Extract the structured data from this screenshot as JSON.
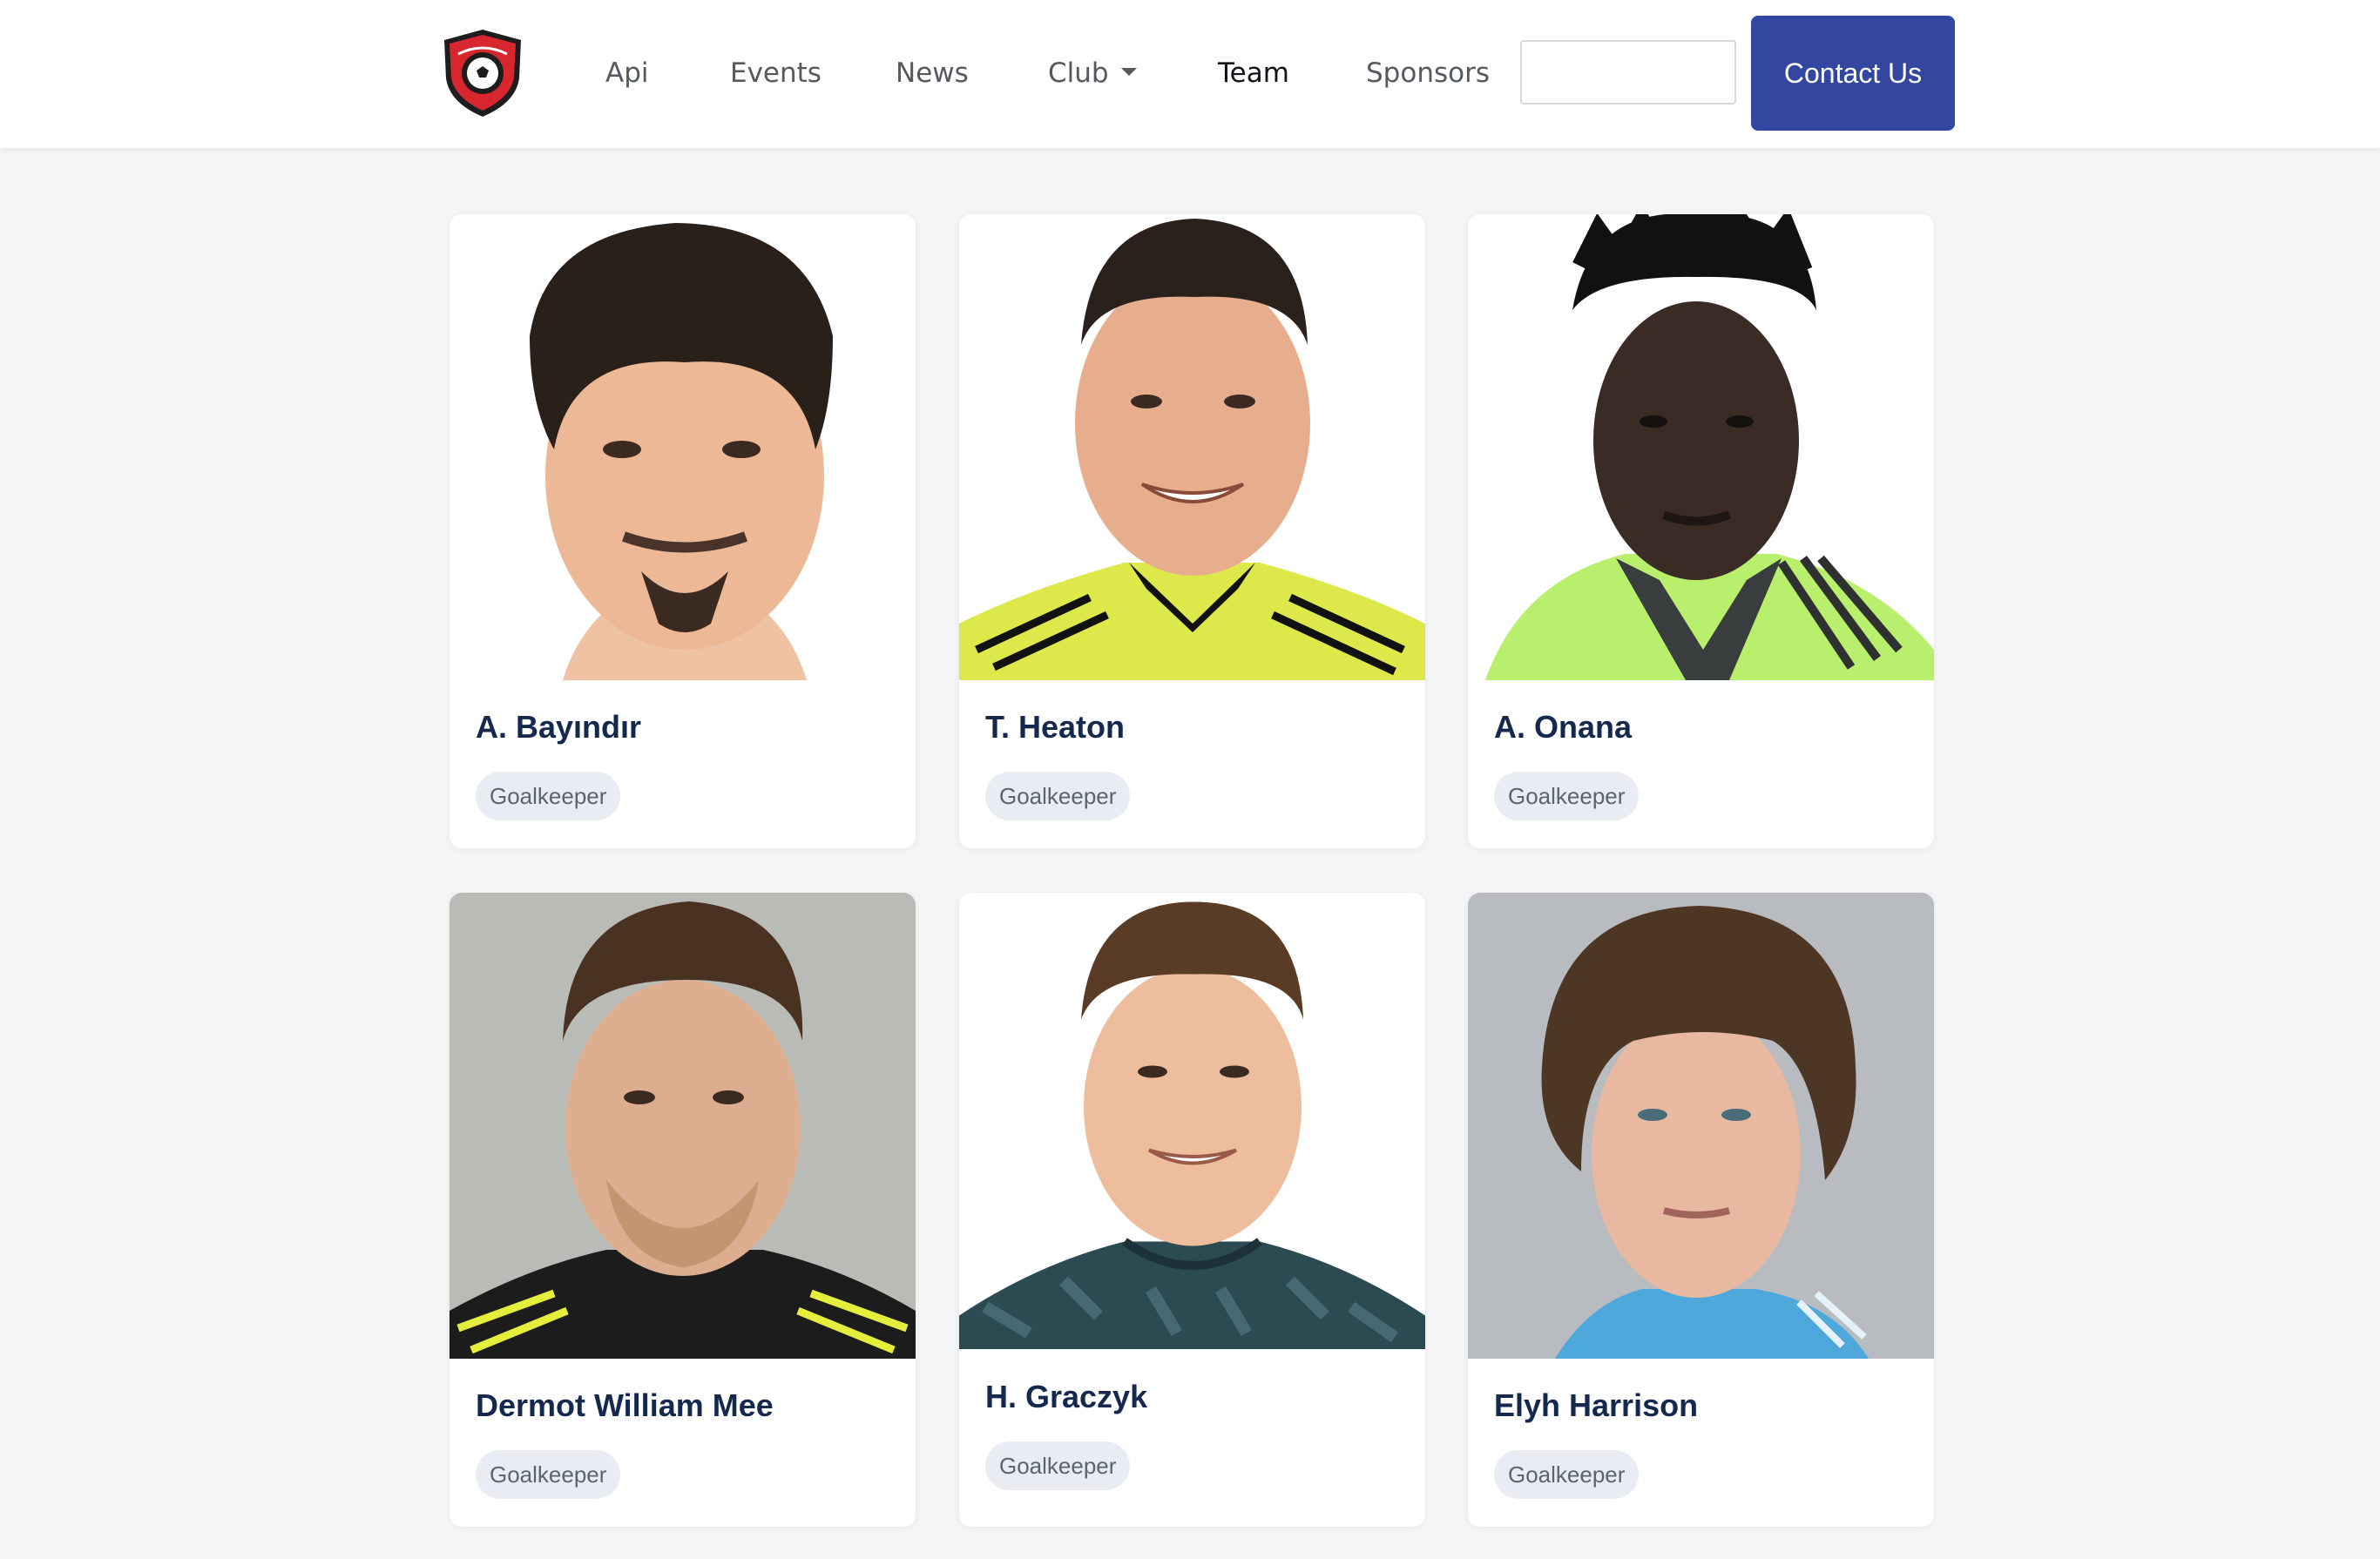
{
  "nav": {
    "logo": "club-crest-logo",
    "links": {
      "api": "Api",
      "events": "Events",
      "news": "News",
      "club": "Club",
      "team": "Team",
      "sponsors": "Sponsors"
    },
    "active": "Team",
    "search": {
      "value": "",
      "placeholder": ""
    },
    "contact_label": "Contact Us"
  },
  "players": [
    {
      "name": "A. Bayındır",
      "position": "Goalkeeper"
    },
    {
      "name": "T. Heaton",
      "position": "Goalkeeper"
    },
    {
      "name": "A. Onana",
      "position": "Goalkeeper"
    },
    {
      "name": "Dermot William Mee",
      "position": "Goalkeeper"
    },
    {
      "name": "H. Graczyk",
      "position": "Goalkeeper"
    },
    {
      "name": "Elyh Harrison",
      "position": "Goalkeeper"
    }
  ],
  "colors": {
    "accent": "#3447a0",
    "name_text": "#15294f",
    "badge_bg": "#e9edf3",
    "page_bg": "#f4f5f7"
  }
}
